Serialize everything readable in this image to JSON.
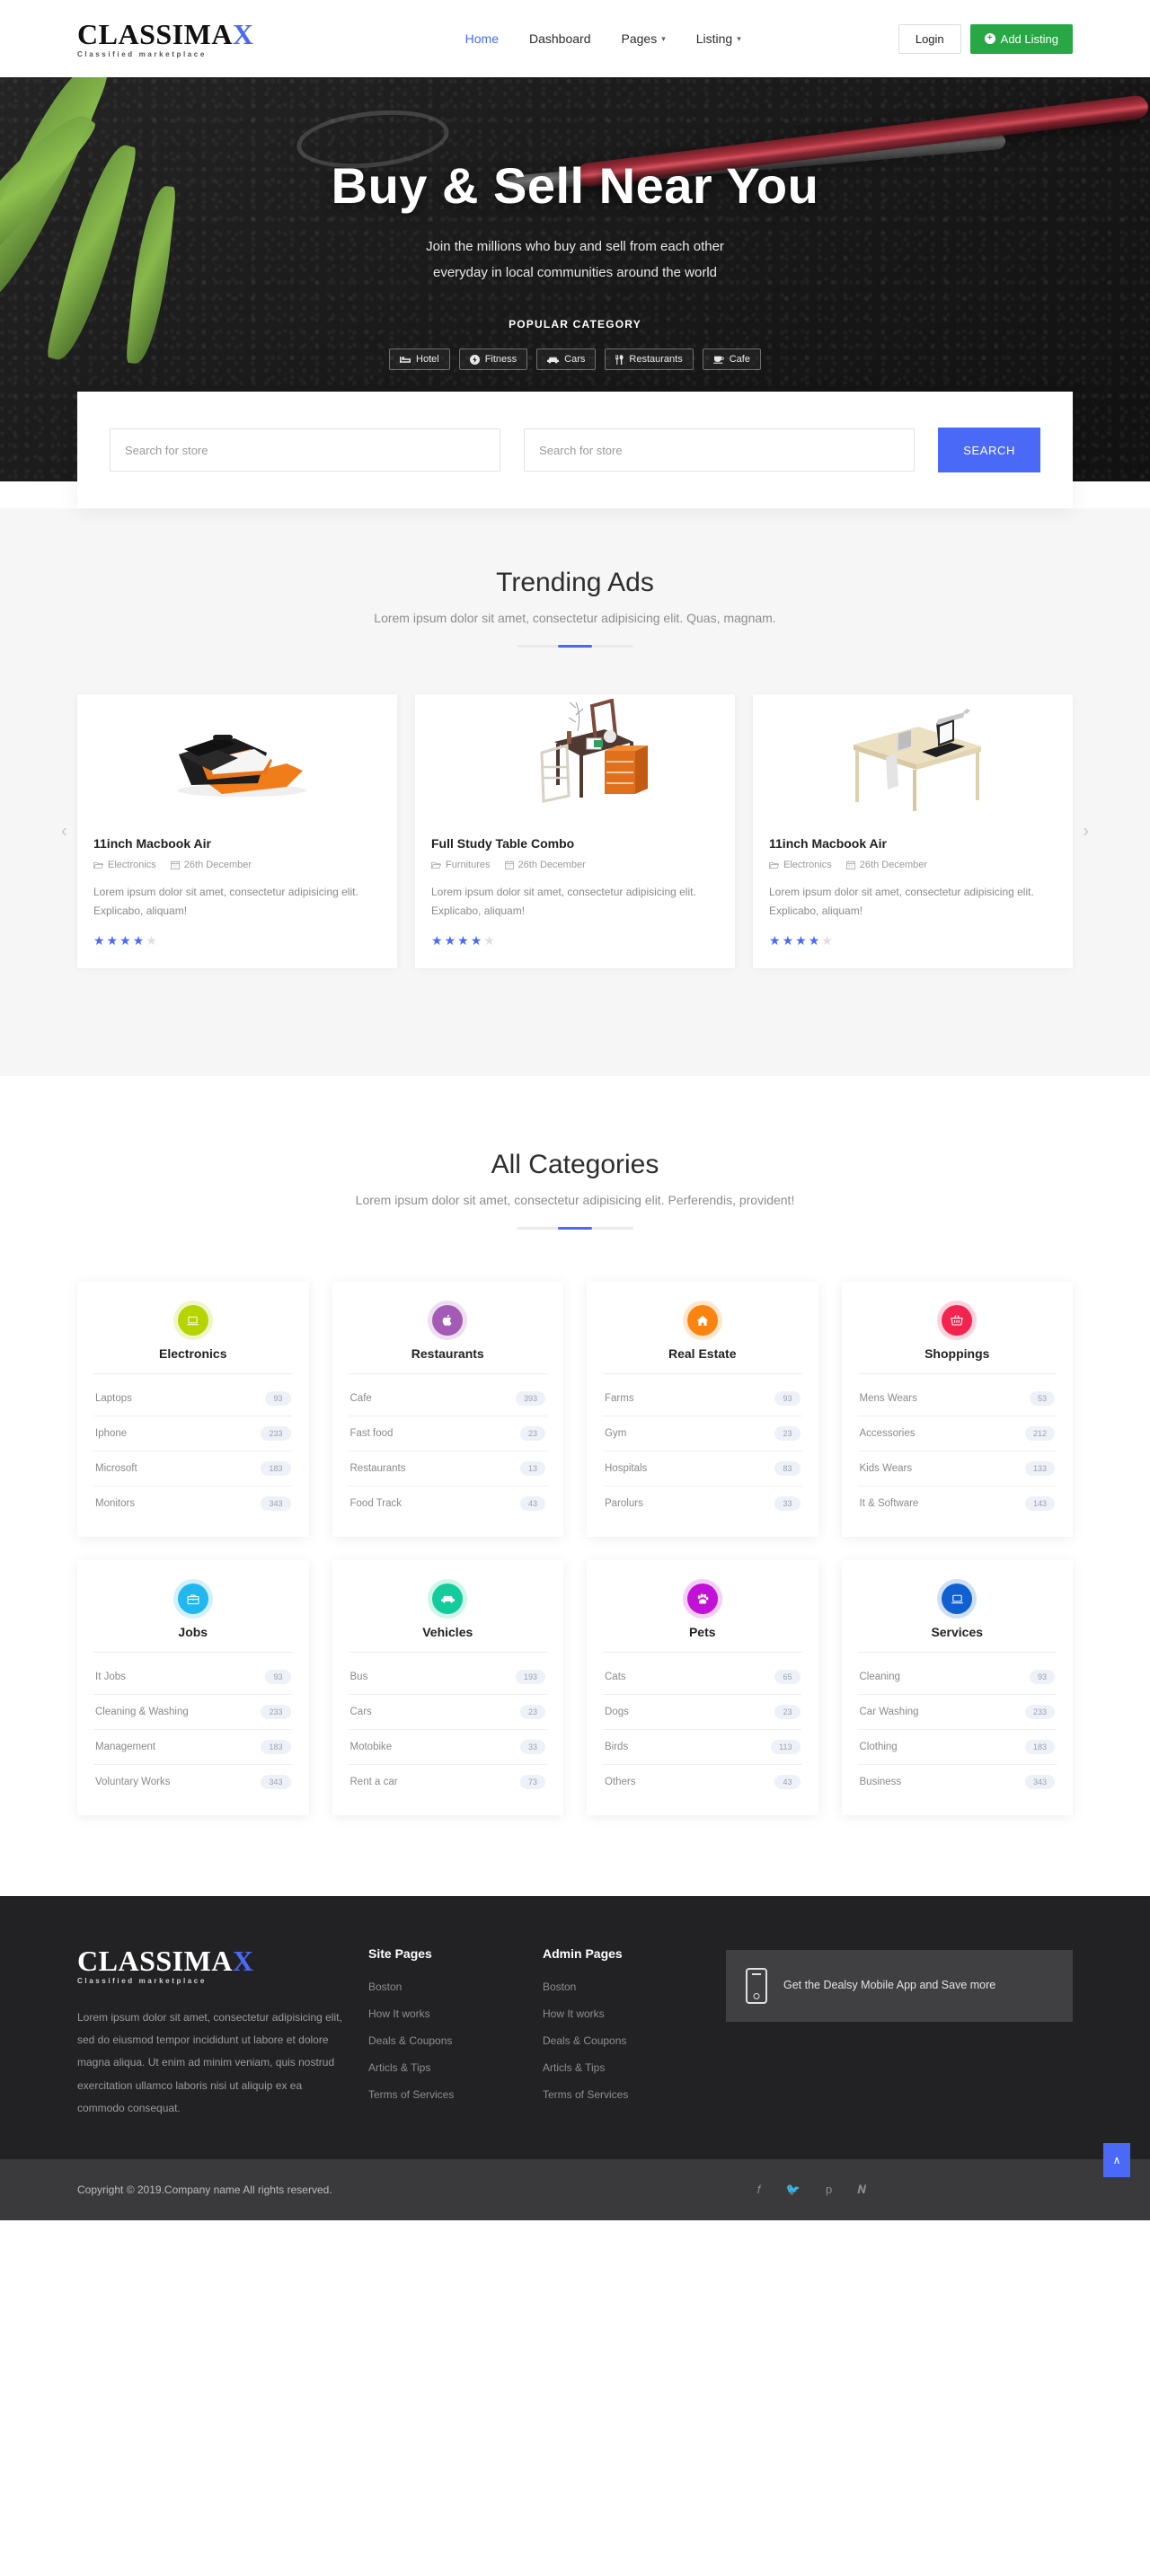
{
  "header": {
    "brand": {
      "word_main": "CLASSIMA",
      "word_accent": "X",
      "tagline": "Classified marketplace"
    },
    "nav": [
      {
        "label": "Home",
        "icon": "",
        "active": true
      },
      {
        "label": "Dashboard",
        "icon": "",
        "active": false
      },
      {
        "label": "Pages",
        "icon": "chevron-down-icon",
        "active": false
      },
      {
        "label": "Listing",
        "icon": "chevron-down-icon",
        "active": false
      }
    ],
    "login_label": "Login",
    "add_listing_label": "Add Listing",
    "add_listing_color": "#28a745"
  },
  "hero": {
    "title": "Buy & Sell Near You",
    "subtitle_line1": "Join the millions who buy and sell from each other",
    "subtitle_line2": "everyday in local communities around the world",
    "popular_label": "POPULAR CATEGORY",
    "categories": [
      {
        "label": "Hotel",
        "icon": "bed-icon"
      },
      {
        "label": "Fitness",
        "icon": "bolt-icon"
      },
      {
        "label": "Cars",
        "icon": "car-icon"
      },
      {
        "label": "Restaurants",
        "icon": "utensils-icon"
      },
      {
        "label": "Cafe",
        "icon": "coffee-icon"
      }
    ]
  },
  "search": {
    "field1_placeholder": "Search for store",
    "field1_value": "",
    "field2_placeholder": "Search for store",
    "field2_value": "",
    "button_label": "SEARCH",
    "button_color": "#4a69f7"
  },
  "trending": {
    "title": "Trending Ads",
    "subtitle": "Lorem ipsum dolor sit amet, consectetur adipisicing elit. Quas, magnam.",
    "prev_arrow": "‹",
    "next_arrow": "›",
    "cards": [
      {
        "title": "11inch Macbook Air",
        "category": "Electronics",
        "date": "26th December",
        "desc": "Lorem ipsum dolor sit amet, consectetur adipisicing elit. Explicabo, aliquam!",
        "rating": 4,
        "image": "black-laptop-bag"
      },
      {
        "title": "Full Study Table Combo",
        "category": "Furnitures",
        "date": "26th December",
        "desc": "Lorem ipsum dolor sit amet, consectetur adipisicing elit. Explicabo, aliquam!",
        "rating": 4,
        "image": "study-table-set"
      },
      {
        "title": "11inch Macbook Air",
        "category": "Electronics",
        "date": "26th December",
        "desc": "Lorem ipsum dolor sit amet, consectetur adipisicing elit. Explicabo, aliquam!",
        "rating": 4,
        "image": "desk-with-laptop"
      }
    ]
  },
  "categories": {
    "title": "All Categories",
    "subtitle": "Lorem ipsum dolor sit amet, consectetur adipisicing elit. Perferendis, provident!",
    "cards": [
      {
        "name": "Electronics",
        "icon": "laptop-icon",
        "color": "#b5d400",
        "items": [
          {
            "label": "Laptops",
            "count": "93"
          },
          {
            "label": "Iphone",
            "count": "233"
          },
          {
            "label": "Microsoft",
            "count": "183"
          },
          {
            "label": "Monitors",
            "count": "343"
          }
        ]
      },
      {
        "name": "Restaurants",
        "icon": "apple-icon",
        "color": "#a35bb5",
        "items": [
          {
            "label": "Cafe",
            "count": "393"
          },
          {
            "label": "Fast food",
            "count": "23"
          },
          {
            "label": "Restaurants",
            "count": "13"
          },
          {
            "label": "Food Track",
            "count": "43"
          }
        ]
      },
      {
        "name": "Real Estate",
        "icon": "home-icon",
        "color": "#fb8410",
        "items": [
          {
            "label": "Farms",
            "count": "93"
          },
          {
            "label": "Gym",
            "count": "23"
          },
          {
            "label": "Hospitals",
            "count": "83"
          },
          {
            "label": "Parolurs",
            "count": "33"
          }
        ]
      },
      {
        "name": "Shoppings",
        "icon": "basket-icon",
        "color": "#f2244f",
        "items": [
          {
            "label": "Mens Wears",
            "count": "53"
          },
          {
            "label": "Accessories",
            "count": "212"
          },
          {
            "label": "Kids Wears",
            "count": "133"
          },
          {
            "label": "It & Software",
            "count": "143"
          }
        ]
      },
      {
        "name": "Jobs",
        "icon": "briefcase-icon",
        "color": "#21b7ef",
        "items": [
          {
            "label": "It Jobs",
            "count": "93"
          },
          {
            "label": "Cleaning & Washing",
            "count": "233"
          },
          {
            "label": "Management",
            "count": "183"
          },
          {
            "label": "Voluntary Works",
            "count": "343"
          }
        ]
      },
      {
        "name": "Vehicles",
        "icon": "car-icon",
        "color": "#13cc9b",
        "items": [
          {
            "label": "Bus",
            "count": "193"
          },
          {
            "label": "Cars",
            "count": "23"
          },
          {
            "label": "Motobike",
            "count": "33"
          },
          {
            "label": "Rent a car",
            "count": "73"
          }
        ]
      },
      {
        "name": "Pets",
        "icon": "paw-icon",
        "color": "#c211d6",
        "items": [
          {
            "label": "Cats",
            "count": "65"
          },
          {
            "label": "Dogs",
            "count": "23"
          },
          {
            "label": "Birds",
            "count": "113"
          },
          {
            "label": "Others",
            "count": "43"
          }
        ]
      },
      {
        "name": "Services",
        "icon": "laptop-icon",
        "color": "#1060d2",
        "items": [
          {
            "label": "Cleaning",
            "count": "93"
          },
          {
            "label": "Car Washing",
            "count": "233"
          },
          {
            "label": "Clothing",
            "count": "183"
          },
          {
            "label": "Business",
            "count": "343"
          }
        ]
      }
    ]
  },
  "footer": {
    "brand": {
      "word_main": "CLASSIMA",
      "word_accent": "X",
      "tagline": "Classified marketplace"
    },
    "about": "Lorem ipsum dolor sit amet, consectetur adipisicing elit, sed do eiusmod tempor incididunt ut labore et dolore magna aliqua. Ut enim ad minim veniam, quis nostrud exercitation ullamco laboris nisi ut aliquip ex ea commodo consequat.",
    "col1_title": "Site Pages",
    "col1_links": [
      "Boston",
      "How It works",
      "Deals & Coupons",
      "Articls & Tips",
      "Terms of Services"
    ],
    "col2_title": "Admin Pages",
    "col2_links": [
      "Boston",
      "How It works",
      "Deals & Coupons",
      "Articls & Tips",
      "Terms of Services"
    ],
    "app_text": "Get the Dealsy Mobile App and Save more",
    "app_icon": "mobile-phone-icon",
    "copyright": "Copyright © 2019.Company name All rights reserved.",
    "socials": [
      {
        "name": "facebook-icon",
        "glyph": "f"
      },
      {
        "name": "twitter-icon",
        "glyph": "🐦"
      },
      {
        "name": "pinterest-icon",
        "glyph": "р"
      },
      {
        "name": "vimeo-icon",
        "glyph": "v"
      }
    ],
    "to_top_glyph": "∧"
  }
}
